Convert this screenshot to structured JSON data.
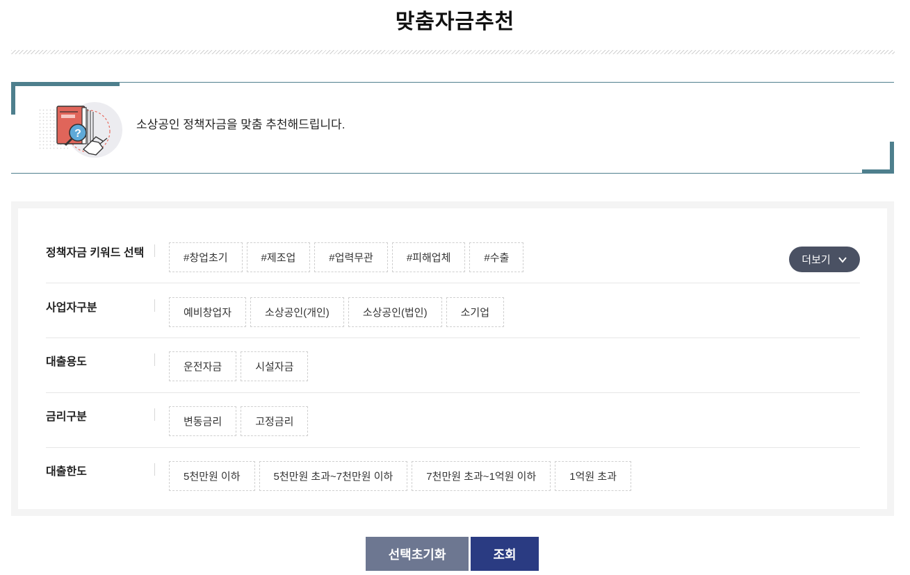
{
  "page_title": "맞춤자금추천",
  "intro": {
    "text": "소상공인 정책자금을 맞춤 추천해드립니다.",
    "icon": "policy-book-handshake-icon"
  },
  "filters": {
    "keyword": {
      "label": "정책자금 키워드 선택",
      "options": [
        "#창업초기",
        "#제조업",
        "#업력무관",
        "#피해업체",
        "#수출"
      ],
      "more_label": "더보기"
    },
    "business_type": {
      "label": "사업자구분",
      "options": [
        "예비창업자",
        "소상공인(개인)",
        "소상공인(법인)",
        "소기업"
      ]
    },
    "loan_purpose": {
      "label": "대출용도",
      "options": [
        "운전자금",
        "시설자금"
      ]
    },
    "interest_type": {
      "label": "금리구분",
      "options": [
        "변동금리",
        "고정금리"
      ]
    },
    "loan_limit": {
      "label": "대출한도",
      "options": [
        "5천만원 이하",
        "5천만원 초과~7천만원 이하",
        "7천만원 초과~1억원 이하",
        "1억원 초과"
      ]
    }
  },
  "buttons": {
    "reset": "선택초기화",
    "search": "조회"
  },
  "colors": {
    "accent_teal": "#4e7f8d",
    "more_button": "#4a5163",
    "reset_button": "#6d7791",
    "search_button": "#2a3b82"
  }
}
